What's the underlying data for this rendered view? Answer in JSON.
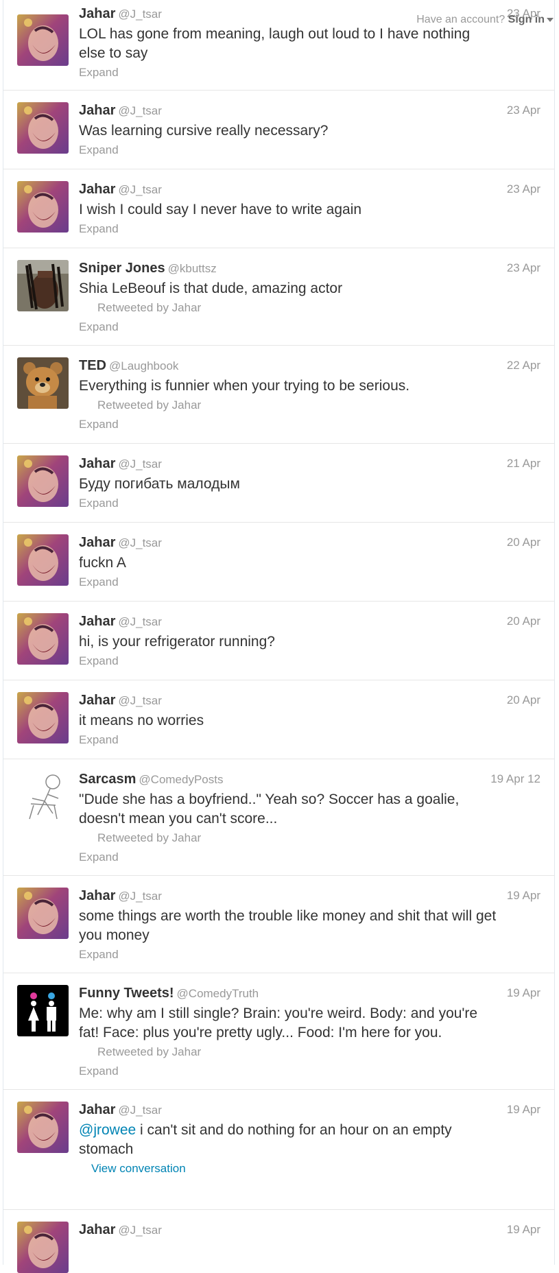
{
  "topbar": {
    "have_account": "Have an account?",
    "sign_in": "Sign in"
  },
  "tweets": [
    {
      "name": "Jahar",
      "handle": "@J_tsar",
      "time": "23 Apr",
      "text": "LOL has gone from meaning, laugh out loud to I have nothing else to say",
      "action": "Expand"
    },
    {
      "name": "Jahar",
      "handle": "@J_tsar",
      "time": "23 Apr",
      "text": "Was learning cursive really necessary?",
      "action": "Expand"
    },
    {
      "name": "Jahar",
      "handle": "@J_tsar",
      "time": "23 Apr",
      "text": "I wish I could say I never have to write again",
      "action": "Expand"
    },
    {
      "name": "Sniper Jones",
      "handle": "@kbuttsz",
      "time": "23 Apr",
      "text": "Shia LeBeouf is that dude, amazing actor",
      "retweet": "Retweeted by Jahar",
      "action": "Expand"
    },
    {
      "name": "TED",
      "handle": "@Laughbook",
      "time": "22 Apr",
      "text": "Everything is funnier when your trying to be serious.",
      "retweet": "Retweeted by Jahar",
      "action": "Expand"
    },
    {
      "name": "Jahar",
      "handle": "@J_tsar",
      "time": "21 Apr",
      "text": "Буду погибать малодым",
      "action": "Expand"
    },
    {
      "name": "Jahar",
      "handle": "@J_tsar",
      "time": "20 Apr",
      "text": "fuckn A",
      "action": "Expand"
    },
    {
      "name": "Jahar",
      "handle": "@J_tsar",
      "time": "20 Apr",
      "text": "hi, is your refrigerator running?",
      "action": "Expand"
    },
    {
      "name": "Jahar",
      "handle": "@J_tsar",
      "time": "20 Apr",
      "text": "it means no worries",
      "action": "Expand"
    },
    {
      "name": "Sarcasm",
      "handle": "@ComedyPosts",
      "time": "19 Apr 12",
      "text": "\"Dude she has a boyfriend..\" Yeah so? Soccer has a goalie, doesn't mean you can't score...",
      "retweet": "Retweeted by Jahar",
      "action": "Expand"
    },
    {
      "name": "Jahar",
      "handle": "@J_tsar",
      "time": "19 Apr",
      "text": "some things are worth the trouble like money and shit that will get you money",
      "action": "Expand"
    },
    {
      "name": "Funny Tweets!",
      "handle": "@ComedyTruth",
      "time": "19 Apr",
      "text": "Me: why am I still single? Brain: you're weird. Body: and you're fat! Face: plus you're pretty ugly... Food: I'm here for you.",
      "retweet": "Retweeted by Jahar",
      "action": "Expand"
    },
    {
      "name": "Jahar",
      "handle": "@J_tsar",
      "time": "19 Apr",
      "mention": "@jrowee",
      "text": " i can't sit and do nothing for an hour on an empty stomach",
      "action": "View conversation"
    },
    {
      "name": "Jahar",
      "handle": "@J_tsar",
      "time": "19 Apr",
      "text": ""
    }
  ]
}
